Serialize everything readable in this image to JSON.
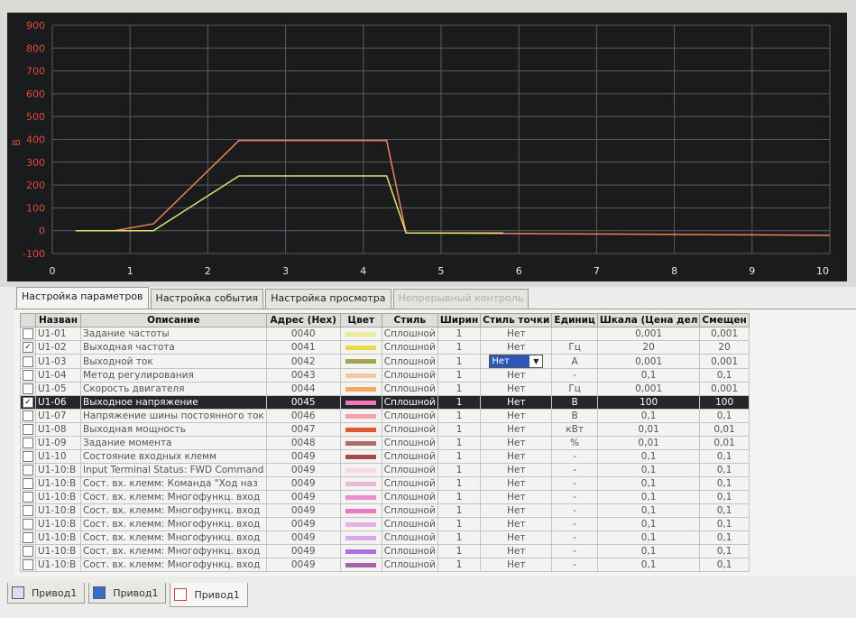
{
  "chart_data": {
    "type": "line",
    "ylabel": "В",
    "xlim": [
      0,
      10
    ],
    "ylim": [
      -100,
      900
    ],
    "x_ticks": [
      "0",
      "1",
      "2",
      "3",
      "4",
      "5",
      "6",
      "7",
      "8",
      "9",
      "10"
    ],
    "y_ticks": [
      "900",
      "800",
      "700",
      "600",
      "500",
      "400",
      "300",
      "200",
      "100",
      "0",
      "-100"
    ],
    "grid": true,
    "series": [
      {
        "color": "#f08060",
        "x": [
          0.3,
          0.8,
          1.3,
          2.4,
          4.3,
          4.55,
          10.0
        ],
        "y": [
          0,
          0,
          30,
          395,
          395,
          -10,
          -20
        ]
      },
      {
        "color": "#e6e070",
        "x": [
          0.3,
          0.9,
          1.3,
          2.4,
          4.3,
          4.55,
          5.8
        ],
        "y": [
          0,
          0,
          0,
          240,
          240,
          -10,
          -10
        ]
      }
    ]
  },
  "tabs": [
    {
      "label": "Настройка параметров"
    },
    {
      "label": "Настройка события"
    },
    {
      "label": "Настройка просмотра"
    },
    {
      "label": "Непрерывный контроль"
    }
  ],
  "table": {
    "headers": [
      "Назван",
      "Описание",
      "Адрес (Hex)",
      "Цвет",
      "Стиль",
      "Ширин",
      "Стиль точки",
      "Единиц",
      "Шкала (Цена дел",
      "Смещен"
    ],
    "dropdown_value": "Нет",
    "rows": [
      {
        "check": "",
        "code": "U1-01",
        "desc": "Задание частоты",
        "addr": "0040",
        "color": "#ece8a0",
        "style": "Сплошной",
        "width": "1",
        "point": "Нет",
        "unit": "",
        "scale": "0,001",
        "offset": "0,001"
      },
      {
        "check": "✓",
        "code": "U1-02",
        "desc": "Выходная частота",
        "addr": "0041",
        "color": "#e6dc46",
        "style": "Сплошной",
        "width": "1",
        "point": "Нет",
        "unit": "Гц",
        "scale": "20",
        "offset": "20"
      },
      {
        "check": "",
        "code": "U1-03",
        "desc": "Выходной ток",
        "addr": "0042",
        "color": "#a8a44a",
        "style": "Сплошной",
        "width": "1",
        "point": "Нет",
        "unit": "A",
        "scale": "0,001",
        "offset": "0,001"
      },
      {
        "check": "",
        "code": "U1-04",
        "desc": "Метод регулирования",
        "addr": "0043",
        "color": "#f2c8a0",
        "style": "Сплошной",
        "width": "1",
        "point": "Нет",
        "unit": "-",
        "scale": "0,1",
        "offset": "0,1"
      },
      {
        "check": "",
        "code": "U1-05",
        "desc": "Скорость двигателя",
        "addr": "0044",
        "color": "#f4a860",
        "style": "Сплошной",
        "width": "1",
        "point": "Нет",
        "unit": "Гц",
        "scale": "0,001",
        "offset": "0,001"
      },
      {
        "check": "✓",
        "code": "U1-06",
        "desc": "Выходное напряжение",
        "addr": "0045",
        "color": "#f078b8",
        "style": "Сплошной",
        "width": "1",
        "point": "Нет",
        "unit": "В",
        "scale": "100",
        "offset": "100"
      },
      {
        "check": "",
        "code": "U1-07",
        "desc": "Напряжение шины постоянного ток",
        "addr": "0046",
        "color": "#f2a0b0",
        "style": "Сплошной",
        "width": "1",
        "point": "Нет",
        "unit": "В",
        "scale": "0,1",
        "offset": "0,1"
      },
      {
        "check": "",
        "code": "U1-08",
        "desc": "Выходная мощность",
        "addr": "0047",
        "color": "#e05838",
        "style": "Сплошной",
        "width": "1",
        "point": "Нет",
        "unit": "кВт",
        "scale": "0,01",
        "offset": "0,01"
      },
      {
        "check": "",
        "code": "U1-09",
        "desc": "Задание момента",
        "addr": "0048",
        "color": "#b06c68",
        "style": "Сплошной",
        "width": "1",
        "point": "Нет",
        "unit": "%",
        "scale": "0,01",
        "offset": "0,01"
      },
      {
        "check": "",
        "code": "U1-10",
        "desc": "Состояние входных клемм",
        "addr": "0049",
        "color": "#a84848",
        "style": "Сплошной",
        "width": "1",
        "point": "Нет",
        "unit": "-",
        "scale": "0,1",
        "offset": "0,1"
      },
      {
        "check": "",
        "code": "U1-10:B",
        "desc": "Input Terminal Status: FWD Command",
        "addr": "0049",
        "color": "#f6d8e4",
        "style": "Сплошной",
        "width": "1",
        "point": "Нет",
        "unit": "-",
        "scale": "0,1",
        "offset": "0,1"
      },
      {
        "check": "",
        "code": "U1-10:B",
        "desc": "Сост. вх. клемм: Команда \"Ход наз",
        "addr": "0049",
        "color": "#f0b8d8",
        "style": "Сплошной",
        "width": "1",
        "point": "Нет",
        "unit": "-",
        "scale": "0,1",
        "offset": "0,1"
      },
      {
        "check": "",
        "code": "U1-10:B",
        "desc": "Сост. вх. клемм: Многофункц. вход",
        "addr": "0049",
        "color": "#e890d0",
        "style": "Сплошной",
        "width": "1",
        "point": "Нет",
        "unit": "-",
        "scale": "0,1",
        "offset": "0,1"
      },
      {
        "check": "",
        "code": "U1-10:B",
        "desc": "Сост. вх. клемм: Многофункц. вход",
        "addr": "0049",
        "color": "#e878c0",
        "style": "Сплошной",
        "width": "1",
        "point": "Нет",
        "unit": "-",
        "scale": "0,1",
        "offset": "0,1"
      },
      {
        "check": "",
        "code": "U1-10:B",
        "desc": "Сост. вх. клемм: Многофункц. вход",
        "addr": "0049",
        "color": "#e8b0e4",
        "style": "Сплошной",
        "width": "1",
        "point": "Нет",
        "unit": "-",
        "scale": "0,1",
        "offset": "0,1"
      },
      {
        "check": "",
        "code": "U1-10:B",
        "desc": "Сост. вх. клемм: Многофункц. вход",
        "addr": "0049",
        "color": "#d8a8e8",
        "style": "Сплошной",
        "width": "1",
        "point": "Нет",
        "unit": "-",
        "scale": "0,1",
        "offset": "0,1"
      },
      {
        "check": "",
        "code": "U1-10:B",
        "desc": "Сост. вх. клемм: Многофункц. вход",
        "addr": "0049",
        "color": "#a870e0",
        "style": "Сплошной",
        "width": "1",
        "point": "Нет",
        "unit": "-",
        "scale": "0,1",
        "offset": "0,1"
      },
      {
        "check": "",
        "code": "U1-10:B",
        "desc": "Сост. вх. клемм: Многофункц. вход",
        "addr": "0049",
        "color": "#a860a8",
        "style": "Сплошной",
        "width": "1",
        "point": "Нет",
        "unit": "-",
        "scale": "0,1",
        "offset": "0,1"
      }
    ]
  },
  "bottom_tabs": [
    {
      "label": "Привод1",
      "icon": "document-icon"
    },
    {
      "label": "Привод1",
      "icon": "house-icon"
    },
    {
      "label": "Привод1",
      "icon": "trend-icon"
    }
  ]
}
